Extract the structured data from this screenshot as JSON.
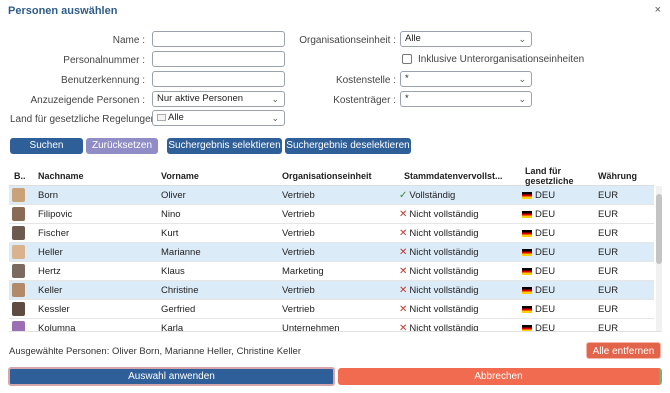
{
  "dialog": {
    "title": "Personen auswählen",
    "close_glyph": "×"
  },
  "form": {
    "name_label": "Name :",
    "personalnummer_label": "Personalnummer :",
    "benutzerkennung_label": "Benutzerkennung :",
    "anzuzeigende_label": "Anzuzeigende Personen :",
    "anzuzeigende_value": "Nur aktive Personen",
    "land_label": "Land für gesetzliche Regelungen :",
    "land_value": "Alle",
    "orgeinheit_label": "Organisationseinheit :",
    "orgeinheit_value": "Alle",
    "inklusive_label": "Inklusive Unterorganisationseinheiten",
    "kostenstelle_label": "Kostenstelle :",
    "kostenstelle_value": "*",
    "kostentraeger_label": "Kostenträger :",
    "kostentraeger_value": "*"
  },
  "actions": {
    "suchen": "Suchen",
    "zuruecksetzen": "Zurücksetzen",
    "selektieren": "Suchergebnis selektieren",
    "deselektieren": "Suchergebnis deselektieren"
  },
  "table": {
    "headers": [
      "B..",
      "Nachname",
      "Vorname",
      "Organisationseinheit",
      "Stammdatenvervollst...",
      "Land für gesetzliche",
      "Währung"
    ],
    "rows": [
      {
        "nachname": "Born",
        "vorname": "Oliver",
        "org": "Vertrieb",
        "status": "Vollständig",
        "land": "DEU",
        "waehrung": "EUR"
      },
      {
        "nachname": "Filipovic",
        "vorname": "Nino",
        "org": "Vertrieb",
        "status": "Nicht vollständig",
        "land": "DEU",
        "waehrung": "EUR"
      },
      {
        "nachname": "Fischer",
        "vorname": "Kurt",
        "org": "Vertrieb",
        "status": "Nicht vollständig",
        "land": "DEU",
        "waehrung": "EUR"
      },
      {
        "nachname": "Heller",
        "vorname": "Marianne",
        "org": "Vertrieb",
        "status": "Nicht vollständig",
        "land": "DEU",
        "waehrung": "EUR"
      },
      {
        "nachname": "Hertz",
        "vorname": "Klaus",
        "org": "Marketing",
        "status": "Nicht vollständig",
        "land": "DEU",
        "waehrung": "EUR"
      },
      {
        "nachname": "Keller",
        "vorname": "Christine",
        "org": "Vertrieb",
        "status": "Nicht vollständig",
        "land": "DEU",
        "waehrung": "EUR"
      },
      {
        "nachname": "Kessler",
        "vorname": "Gerfried",
        "org": "Vertrieb",
        "status": "Nicht vollständig",
        "land": "DEU",
        "waehrung": "EUR"
      },
      {
        "nachname": "Kolumna",
        "vorname": "Karla",
        "org": "Unternehmen",
        "status": "Nicht vollständig",
        "land": "DEU",
        "waehrung": "EUR"
      }
    ]
  },
  "footer": {
    "selected_text": "Ausgewählte Personen: Oliver Born, Marianne Heller, Christine Keller",
    "alle_entfernen": "Alle entfernen",
    "apply": "Auswahl anwenden",
    "cancel": "Abbrechen"
  },
  "colors": {
    "primary": "#2f5f98",
    "secondary": "#8f8cc6",
    "danger": "#f06b4f",
    "selected_row": "#dcebf8"
  }
}
